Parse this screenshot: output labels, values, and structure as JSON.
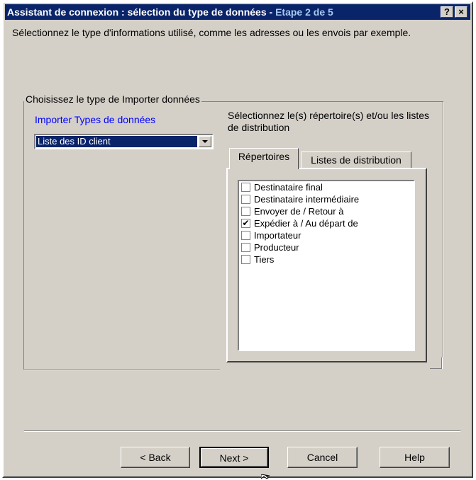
{
  "window": {
    "title": "Assistant de connexion : sélection du type de données - ",
    "title_step": "Etape 2 de 5",
    "help_button": "?",
    "close_button": "×"
  },
  "intro_text": "Sélectionnez le type d'informations utilisé, comme les adresses ou les envois par exemple.",
  "group": {
    "legend": "Choisissez le type de Importer données",
    "import_types_label": "Importer Types de données",
    "import_type_selected": "Liste des ID client",
    "directories_label": "Sélectionnez le(s) répertoire(s) et/ou les listes de distribution"
  },
  "tabs": [
    {
      "label": "Répertoires",
      "active": true
    },
    {
      "label": "Listes de distribution",
      "active": false
    }
  ],
  "directory_items": [
    {
      "label": "Destinataire final",
      "checked": false,
      "mark": ""
    },
    {
      "label": "Destinataire intermédiaire",
      "checked": false,
      "mark": ""
    },
    {
      "label": "Envoyer de / Retour à",
      "checked": false,
      "mark": ""
    },
    {
      "label": "Expédier à / Au départ de",
      "checked": true,
      "mark": "✔"
    },
    {
      "label": "Importateur",
      "checked": false,
      "mark": ""
    },
    {
      "label": "Producteur",
      "checked": false,
      "mark": ""
    },
    {
      "label": "Tiers",
      "checked": false,
      "mark": ""
    }
  ],
  "buttons": {
    "back": "< Back",
    "next": "Next >",
    "cancel": "Cancel",
    "help": "Help"
  }
}
